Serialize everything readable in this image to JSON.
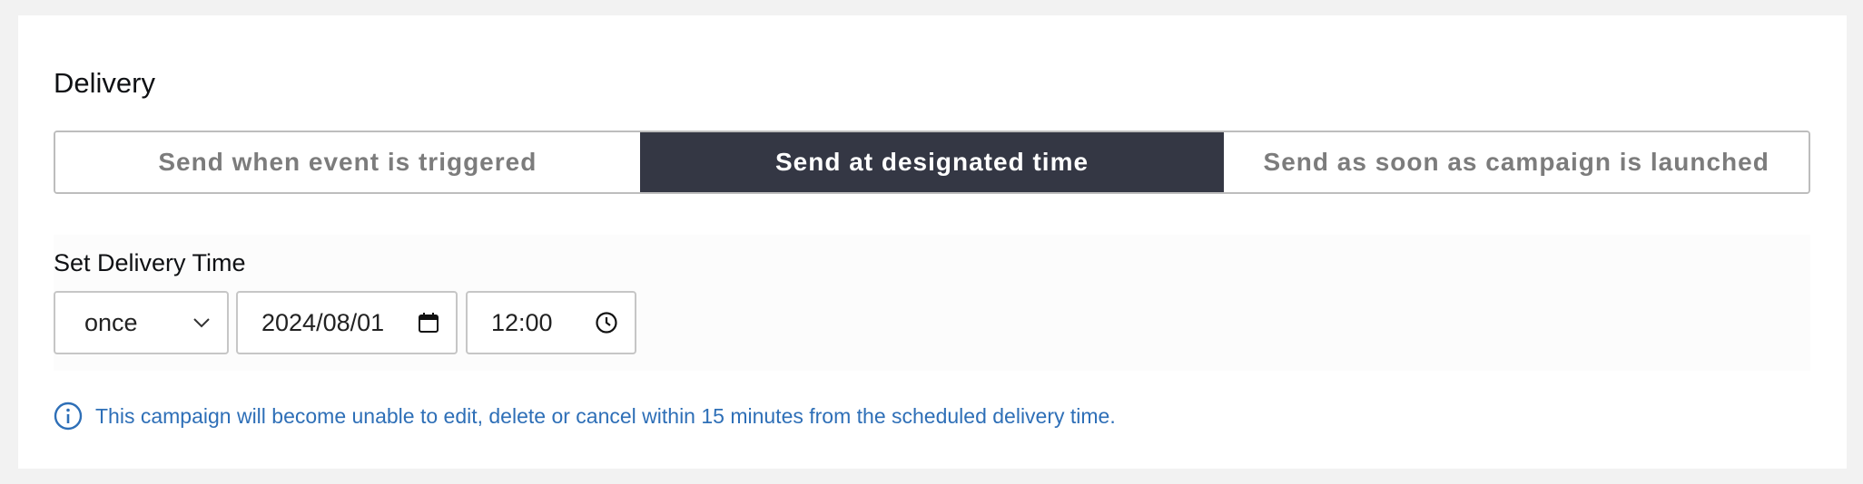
{
  "section": {
    "title": "Delivery"
  },
  "delivery_modes": [
    {
      "label": "Send when event is triggered",
      "active": false
    },
    {
      "label": "Send at designated time",
      "active": true
    },
    {
      "label": "Send as soon as campaign is launched",
      "active": false
    }
  ],
  "delivery_time": {
    "label": "Set Delivery Time",
    "frequency": "once",
    "date": "2024/08/01",
    "time": "12:00"
  },
  "notice": {
    "text": "This campaign will become unable to edit, delete or cancel within 15 minutes from the scheduled delivery time."
  },
  "icons": {
    "frequency": "chevron-down-icon",
    "date": "calendar-icon",
    "time": "clock-icon",
    "notice": "info-icon"
  },
  "colors": {
    "active_segment_bg": "#343744",
    "info_text": "#2e6fb7",
    "page_bg": "#f2f2f2"
  }
}
